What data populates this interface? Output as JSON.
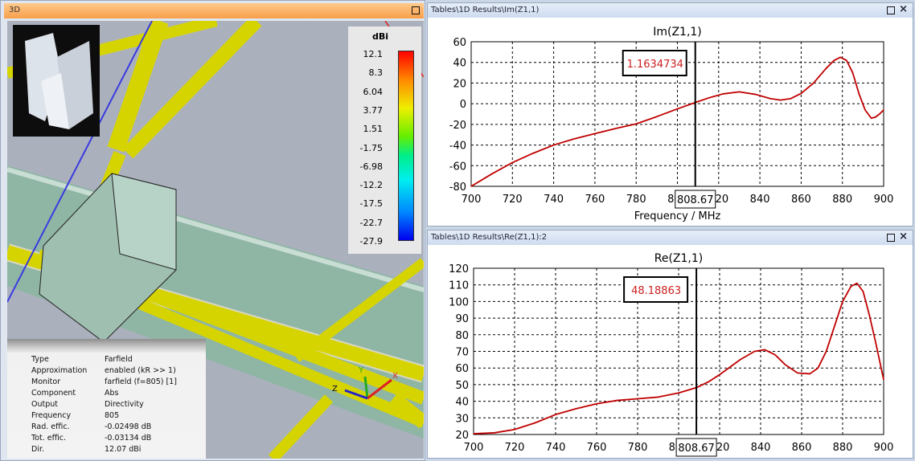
{
  "panel3d": {
    "title": "3D",
    "legend": {
      "unit": "dBi",
      "ticks": [
        "12.1",
        "8.3",
        "6.04",
        "3.77",
        "1.51",
        "-1.75",
        "-6.98",
        "-12.2",
        "-17.5",
        "-22.7",
        "-27.9"
      ]
    },
    "info": [
      [
        "Type",
        "Farfield"
      ],
      [
        "Approximation",
        "enabled (kR >> 1)"
      ],
      [
        "Monitor",
        "farfield (f=805) [1]"
      ],
      [
        "Component",
        "Abs"
      ],
      [
        "Output",
        "Directivity"
      ],
      [
        "Frequency",
        "805"
      ],
      [
        "Rad. effic.",
        "-0.02498 dB"
      ],
      [
        "Tot. effic.",
        "-0.03134 dB"
      ],
      [
        "Dir.",
        "12.07 dBi"
      ]
    ],
    "axes": {
      "x": "X",
      "y": "Y",
      "z": "Z"
    }
  },
  "colors": {
    "curve": "#c00000",
    "marker_text": "#cc2020",
    "title3d": "#f7a04b"
  },
  "chart_data": [
    {
      "type": "line",
      "panel_title": "Tables\\1D Results\\Im(Z1,1)",
      "title": "Im(Z1,1)",
      "xlabel": "Frequency / MHz",
      "ylabel": "",
      "xlim": [
        700,
        900
      ],
      "ylim": [
        -80,
        60
      ],
      "xticks": [
        "700",
        "720",
        "740",
        "760",
        "780",
        "800",
        "820",
        "840",
        "860",
        "880",
        "900"
      ],
      "yticks": [
        "60",
        "40",
        "20",
        "0",
        "-20",
        "-40",
        "-60",
        "-80"
      ],
      "grid": true,
      "marker": {
        "x": 808.67,
        "x_label": "808.67",
        "y_label": "1.1634734"
      },
      "x": [
        700,
        710,
        720,
        730,
        740,
        750,
        760,
        770,
        780,
        790,
        800,
        808.67,
        815,
        822,
        830,
        838,
        845,
        850,
        855,
        860,
        866,
        872,
        876,
        879,
        882,
        885,
        888,
        891,
        894,
        896,
        898,
        900
      ],
      "values": [
        -80,
        -68,
        -57,
        -48,
        -40,
        -34,
        -29,
        -24,
        -19.5,
        -12.5,
        -5,
        1.16,
        5.5,
        9.5,
        11.5,
        9,
        5,
        3.5,
        5,
        10,
        20,
        34,
        42,
        45,
        42,
        30,
        10,
        -6,
        -14,
        -13,
        -10,
        -6
      ]
    },
    {
      "type": "line",
      "panel_title": "Tables\\1D Results\\Re(Z1,1):2",
      "title": "Re(Z1,1)",
      "xlabel": "Frequency / MHz",
      "ylabel": "",
      "xlim": [
        700,
        900
      ],
      "ylim": [
        20,
        120
      ],
      "xticks": [
        "700",
        "720",
        "740",
        "760",
        "780",
        "800",
        "820",
        "840",
        "860",
        "880",
        "900"
      ],
      "yticks": [
        "120",
        "110",
        "100",
        "90",
        "80",
        "70",
        "60",
        "50",
        "40",
        "30",
        "20"
      ],
      "grid": true,
      "marker": {
        "x": 808.67,
        "x_label": "808.67",
        "y_label": "48.18863"
      },
      "x": [
        700,
        710,
        720,
        730,
        740,
        750,
        760,
        770,
        780,
        790,
        800,
        808.67,
        815,
        820,
        830,
        837,
        842,
        847,
        852,
        858,
        864,
        868,
        872,
        876,
        880,
        884,
        887,
        890,
        893,
        896,
        900
      ],
      "values": [
        20.5,
        21,
        23,
        27,
        32,
        35.5,
        38.5,
        40.5,
        41.5,
        42.5,
        45,
        48.19,
        52,
        56,
        65,
        70,
        71,
        68,
        62,
        57,
        56.5,
        60,
        70,
        85,
        100,
        109,
        111,
        106,
        92,
        76,
        53
      ]
    }
  ]
}
